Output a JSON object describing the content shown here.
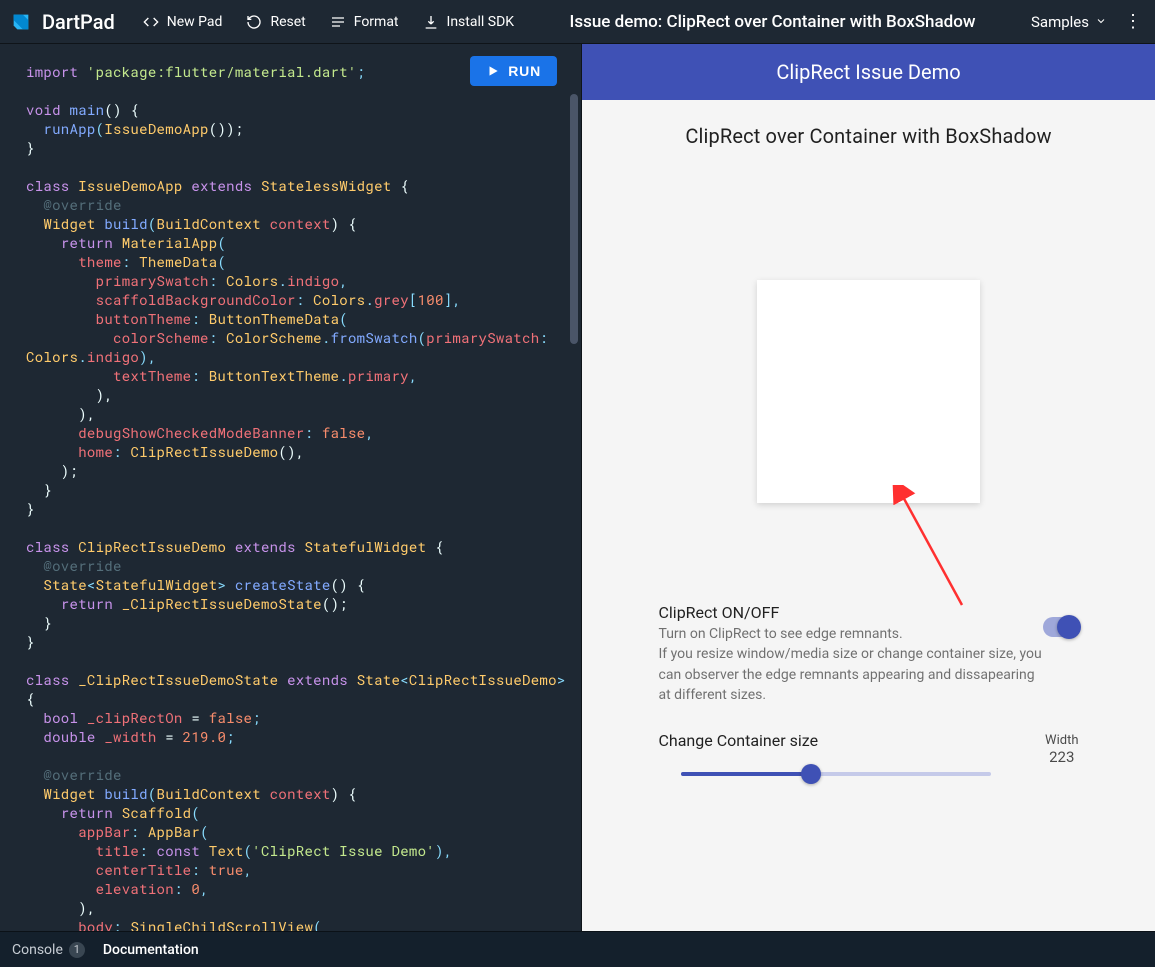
{
  "brand": "DartPad",
  "toolbar": {
    "new_pad": "New Pad",
    "reset": "Reset",
    "format": "Format",
    "install_sdk": "Install SDK",
    "samples": "Samples"
  },
  "title": "Issue demo: ClipRect over Container with BoxShadow",
  "run_label": "RUN",
  "code": {
    "l1a": "import ",
    "l1b": "'package:flutter/material.dart'",
    "l1c": ";",
    "l2a": "void ",
    "l2b": "main",
    "l2c": "() {",
    "l3a": "  ",
    "l3b": "runApp",
    "l3c": "(",
    "l3d": "IssueDemoApp",
    "l3e": "());",
    "l4": "}",
    "l5a": "class ",
    "l5b": "IssueDemoApp ",
    "l5c": "extends ",
    "l5d": "StatelessWidget ",
    "l5e": "{",
    "l6": "  @override",
    "l7a": "  ",
    "l7b": "Widget ",
    "l7c": "build",
    "l7d": "(",
    "l7e": "BuildContext ",
    "l7f": "context",
    "l7g": ") {",
    "l8a": "    ",
    "l8b": "return ",
    "l8c": "MaterialApp",
    "l8d": "(",
    "l9a": "      ",
    "l9b": "theme",
    "l9c": ": ",
    "l9d": "ThemeData",
    "l9e": "(",
    "l10a": "        ",
    "l10b": "primarySwatch",
    "l10c": ": ",
    "l10d": "Colors",
    "l10e": ".",
    "l10f": "indigo",
    "l10g": ",",
    "l11a": "        ",
    "l11b": "scaffoldBackgroundColor",
    "l11c": ": ",
    "l11d": "Colors",
    "l11e": ".",
    "l11f": "grey",
    "l11g": "[",
    "l11h": "100",
    "l11i": "],",
    "l12a": "        ",
    "l12b": "buttonTheme",
    "l12c": ": ",
    "l12d": "ButtonThemeData",
    "l12e": "(",
    "l13a": "          ",
    "l13b": "colorScheme",
    "l13c": ": ",
    "l13d": "ColorScheme",
    "l13e": ".",
    "l13f": "fromSwatch",
    "l13g": "(",
    "l13h": "primarySwatch",
    "l13i": ": ",
    "l14a": "Colors",
    "l14b": ".",
    "l14c": "indigo",
    "l14d": "),",
    "l15a": "          ",
    "l15b": "textTheme",
    "l15c": ": ",
    "l15d": "ButtonTextTheme",
    "l15e": ".",
    "l15f": "primary",
    "l15g": ",",
    "l16": "        ),",
    "l17": "      ),",
    "l18a": "      ",
    "l18b": "debugShowCheckedModeBanner",
    "l18c": ": ",
    "l18d": "false",
    "l18e": ",",
    "l19a": "      ",
    "l19b": "home",
    "l19c": ": ",
    "l19d": "ClipRectIssueDemo",
    "l19e": "(),",
    "l20": "    );",
    "l21": "  }",
    "l22": "}",
    "l23a": "class ",
    "l23b": "ClipRectIssueDemo ",
    "l23c": "extends ",
    "l23d": "StatefulWidget ",
    "l23e": "{",
    "l24": "  @override",
    "l25a": "  ",
    "l25b": "State",
    "l25c": "<",
    "l25d": "StatefulWidget",
    "l25e": "> ",
    "l25f": "createState",
    "l25g": "() {",
    "l26a": "    ",
    "l26b": "return ",
    "l26c": "_ClipRectIssueDemoState",
    "l26d": "();",
    "l27": "  }",
    "l28": "}",
    "l29a": "class ",
    "l29b": "_ClipRectIssueDemoState ",
    "l29c": "extends ",
    "l29d": "State",
    "l29e": "<",
    "l29f": "ClipRectIssueDemo",
    "l29g": "> ",
    "l30": "{",
    "l31a": "  bool ",
    "l31b": "_clipRectOn",
    "l31c": " = ",
    "l31d": "false",
    "l31e": ";",
    "l32a": "  double ",
    "l32b": "_width",
    "l32c": " = ",
    "l32d": "219.0",
    "l32e": ";",
    "l33": "  @override",
    "l34a": "  ",
    "l34b": "Widget ",
    "l34c": "build",
    "l34d": "(",
    "l34e": "BuildContext ",
    "l34f": "context",
    "l34g": ") {",
    "l35a": "    ",
    "l35b": "return ",
    "l35c": "Scaffold",
    "l35d": "(",
    "l36a": "      ",
    "l36b": "appBar",
    "l36c": ": ",
    "l36d": "AppBar",
    "l36e": "(",
    "l37a": "        ",
    "l37b": "title",
    "l37c": ": ",
    "l37d": "const ",
    "l37e": "Text",
    "l37f": "(",
    "l37g": "'ClipRect Issue Demo'",
    "l37h": "),",
    "l38a": "        ",
    "l38b": "centerTitle",
    "l38c": ": ",
    "l38d": "true",
    "l38e": ",",
    "l39a": "        ",
    "l39b": "elevation",
    "l39c": ": ",
    "l39d": "0",
    "l39e": ",",
    "l40": "      ),",
    "l41a": "      ",
    "l41b": "body",
    "l41c": ": ",
    "l41d": "SingleChildScrollView",
    "l41e": "("
  },
  "preview": {
    "appbar_title": "ClipRect Issue Demo",
    "heading": "ClipRect over Container with BoxShadow",
    "clip_label": "ClipRect ON/OFF",
    "clip_sub": "Turn on ClipRect to see edge remnants.\nIf you resize window/media size or change container size, you can observer the edge remnants appearing and dissapearing at different sizes.",
    "slider_label": "Change Container size",
    "width_label": "Width",
    "width_value": "223"
  },
  "bottom": {
    "console": "Console",
    "console_badge": "1",
    "documentation": "Documentation"
  }
}
